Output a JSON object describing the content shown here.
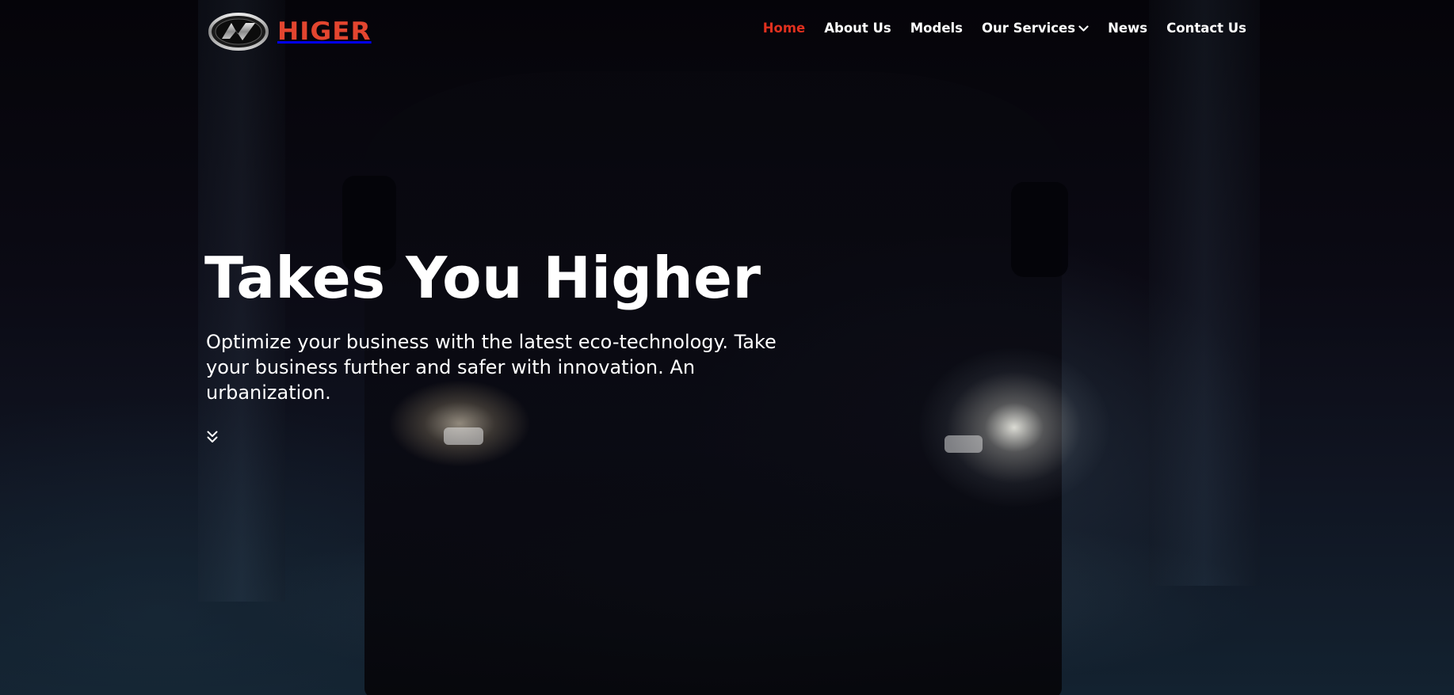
{
  "brand": {
    "name": "HIGER",
    "color": "#e3452f",
    "emblem_icon": "higer-emblem-icon"
  },
  "nav": {
    "items": [
      {
        "label": "Home",
        "active": true
      },
      {
        "label": "About Us",
        "active": false
      },
      {
        "label": "Models",
        "active": false
      },
      {
        "label": "Our Services",
        "active": false,
        "icon": "chevron-down-icon"
      },
      {
        "label": "News",
        "active": false
      },
      {
        "label": "Contact Us",
        "active": false
      }
    ],
    "active_color": "#e0301e",
    "text_color": "#ffffff"
  },
  "hero": {
    "title": "Takes You Higher",
    "subtitle": "Optimize your business with the latest eco-technology. Take your business further and safer with innovation. An urbanization.",
    "scroll_icon": "double-chevron-down-icon",
    "background": "dark photo of van with headlights on"
  }
}
